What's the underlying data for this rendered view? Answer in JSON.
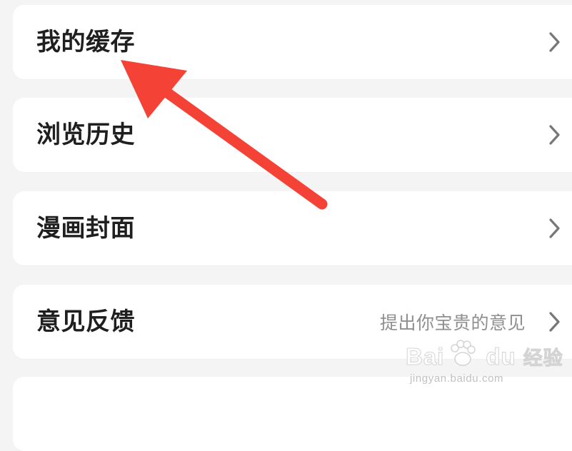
{
  "menu": {
    "items": [
      {
        "label": "我的缓存"
      },
      {
        "label": "浏览历史"
      },
      {
        "label": "漫画封面"
      },
      {
        "label": "意见反馈",
        "hint": "提出你宝贵的意见"
      },
      {
        "label": ""
      }
    ]
  },
  "annotation": {
    "arrow_color": "#f44336"
  },
  "watermark": {
    "brand_left": "Bai",
    "brand_right": "du",
    "brand_cn": "经验",
    "url": "jingyan.baidu.com"
  },
  "colors": {
    "background": "#f4f4f4",
    "card": "#ffffff",
    "label": "#1f1f1f",
    "hint": "#8f8f8f",
    "chevron": "#777777"
  },
  "icons": {
    "chevron": "chevron-right-icon",
    "watermark_paw": "paw-icon"
  }
}
